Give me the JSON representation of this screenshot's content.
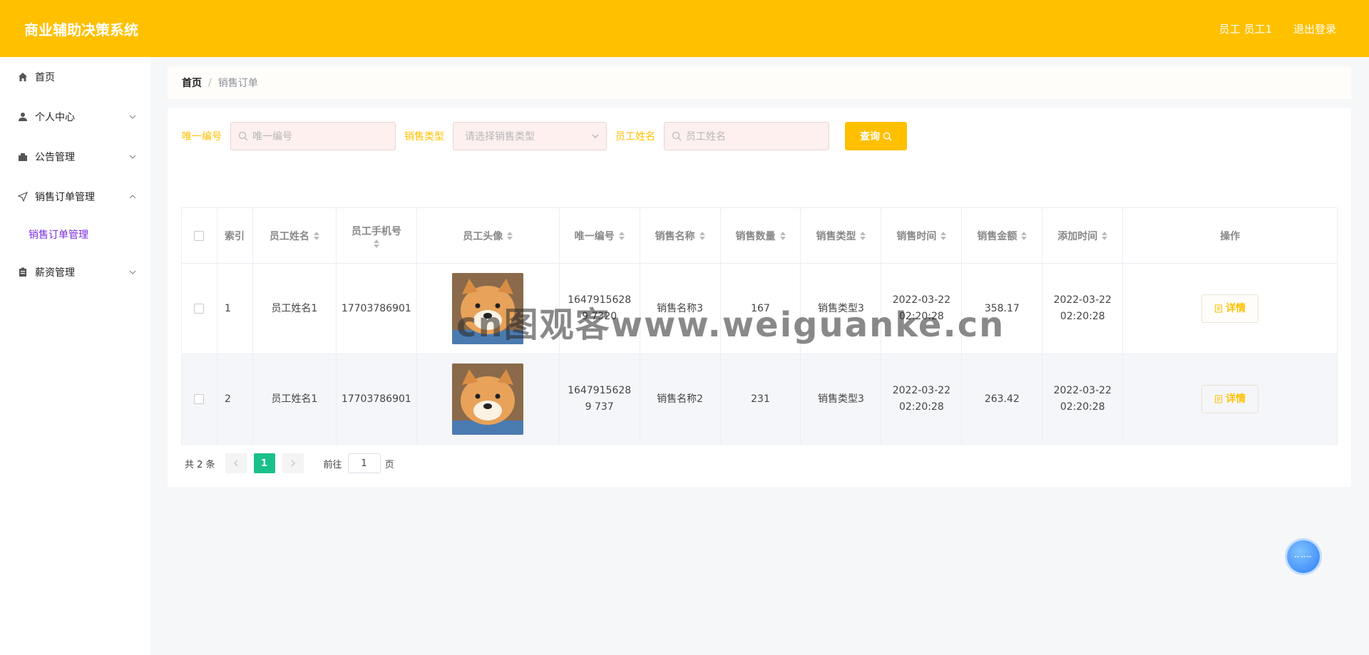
{
  "header": {
    "title": "商业辅助决策系统",
    "user_label": "员工 员工1",
    "logout_label": "退出登录"
  },
  "sidebar": {
    "items": [
      {
        "label": "首页",
        "icon": "home-icon"
      },
      {
        "label": "个人中心",
        "icon": "user-icon"
      },
      {
        "label": "公告管理",
        "icon": "announcement-icon"
      },
      {
        "label": "销售订单管理",
        "icon": "send-icon",
        "expanded": true
      },
      {
        "label": "销售订单管理",
        "sub": true,
        "active": true
      },
      {
        "label": "薪资管理",
        "icon": "clipboard-icon"
      }
    ]
  },
  "breadcrumb": {
    "home": "首页",
    "separator": "/",
    "current": "销售订单"
  },
  "search": {
    "id_label": "唯一编号",
    "id_placeholder": "唯一编号",
    "type_label": "销售类型",
    "type_placeholder": "请选择销售类型",
    "name_label": "员工姓名",
    "name_placeholder": "员工姓名",
    "query_label": "查询"
  },
  "table": {
    "headers": {
      "index": "索引",
      "name": "员工姓名",
      "phone": "员工手机号",
      "avatar": "员工头像",
      "uid": "唯一编号",
      "sale_name": "销售名称",
      "qty": "销售数量",
      "sale_type": "销售类型",
      "sale_time": "销售时间",
      "amount": "销售金额",
      "add_time": "添加时间",
      "action": "操作"
    },
    "rows": [
      {
        "index": "1",
        "name": "员工姓名1",
        "phone": "17703786901",
        "uid": "16479156289 7320",
        "sale_name": "销售名称3",
        "qty": "167",
        "sale_type": "销售类型3",
        "sale_time": "2022-03-22 02:20:28",
        "amount": "358.17",
        "add_time": "2022-03-22 02:20:28",
        "detail": "详情"
      },
      {
        "index": "2",
        "name": "员工姓名1",
        "phone": "17703786901",
        "uid": "16479156289 737",
        "sale_name": "销售名称2",
        "qty": "231",
        "sale_type": "销售类型3",
        "sale_time": "2022-03-22 02:20:28",
        "amount": "263.42",
        "add_time": "2022-03-22 02:20:28",
        "detail": "详情"
      }
    ]
  },
  "pagination": {
    "total": "共 2 条",
    "current_page": "1",
    "goto_label": "前往",
    "goto_value": "1",
    "page_suffix": "页"
  },
  "watermark": "cn图观客www.weiguanke.cn",
  "colors": {
    "brand": "#ffc000",
    "active_menu": "#7b2ce0",
    "page_active": "#1ac089"
  }
}
